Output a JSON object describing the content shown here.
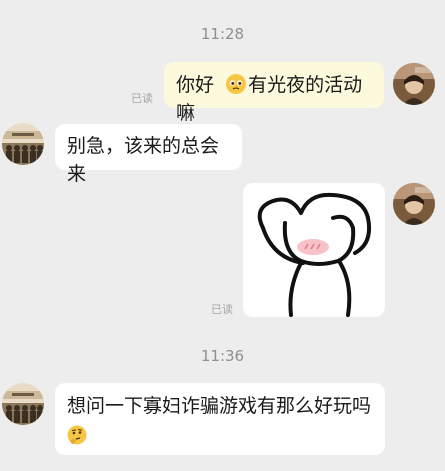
{
  "chat": {
    "timestamps": [
      "11:28",
      "11:36"
    ],
    "read_label": "已读",
    "messages": [
      {
        "sender": "me",
        "text_before_emoji": "你好",
        "emoji": "pleading-face",
        "text_after_emoji": "有光夜的活动嘛",
        "status": "已读"
      },
      {
        "sender": "them",
        "text": "别急，该来的总会来"
      },
      {
        "sender": "me",
        "type": "sticker",
        "sticker": "cartoon-hands-over-blushing-face",
        "status": "已读"
      },
      {
        "sender": "them",
        "text": "想问一下寡妇诈骗游戏有那么好玩吗",
        "emoji": "thinking-face"
      }
    ]
  },
  "colors": {
    "background": "#ededed",
    "my_bubble": "#fdf9dd",
    "their_bubble": "#ffffff",
    "timestamp_text": "#8f8f8f",
    "read_text": "#a6a6a6"
  },
  "icons": {
    "my_avatar": "avatar-portrait-icon",
    "their_avatar": "group-photo-avatar-icon"
  }
}
